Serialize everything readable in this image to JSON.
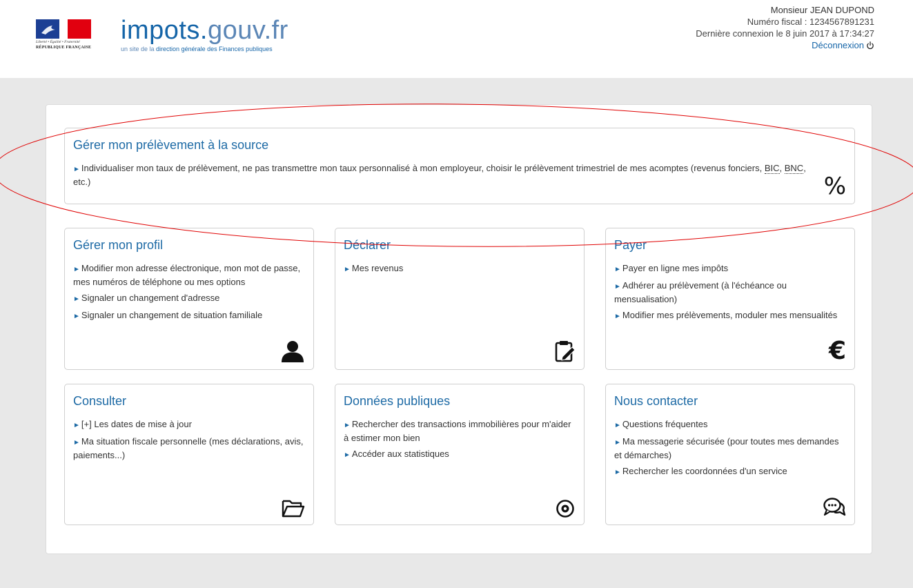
{
  "header": {
    "republique": {
      "motto": "Liberté • Égalité • Fraternité",
      "name": "RÉPUBLIQUE FRANÇAISE"
    },
    "logo": {
      "name_main": "impots.",
      "name_domain": "gouv.fr",
      "tagline_prefix": "un site de la ",
      "tagline_main": "direction générale des Finances publiques"
    },
    "user": {
      "name": "Monsieur JEAN DUPOND",
      "fiscal_number": "Numéro fiscal : 1234567891231",
      "last_login": "Dernière connexion le 8 juin 2017 à 17:34:27",
      "logout_label": "Déconnexion"
    }
  },
  "cards": {
    "prelevement": {
      "title": "Gérer mon prélèvement à la source",
      "item_text": "Individualiser mon taux de prélèvement, ne pas transmettre mon taux personnalisé à mon employeur, choisir le prélèvement trimestriel de mes acomptes (revenus fonciers, ",
      "abbr1": "BIC",
      "sep": ", ",
      "abbr2": "BNC",
      "tail": ", etc.)",
      "icon_symbol": "%",
      "icon": "percent-icon"
    },
    "profil": {
      "title": "Gérer mon profil",
      "items": [
        "Modifier mon adresse électronique, mon mot de passe, mes numéros de téléphone ou mes options",
        "Signaler un changement d'adresse",
        "Signaler un changement de situation familiale"
      ],
      "icon": "user-icon"
    },
    "declarer": {
      "title": "Déclarer",
      "items": [
        "Mes revenus"
      ],
      "icon": "clipboard-edit-icon"
    },
    "payer": {
      "title": "Payer",
      "items": [
        "Payer en ligne mes impôts",
        "Adhérer au prélèvement (à l'échéance ou mensualisation)",
        "Modifier mes prélèvements, moduler mes mensualités"
      ],
      "icon_symbol": "€",
      "icon": "euro-icon"
    },
    "consulter": {
      "title": "Consulter",
      "items": [
        "[+] Les dates de mise à jour",
        "Ma situation fiscale personnelle (mes déclarations, avis, paiements...)"
      ],
      "icon": "folder-open-icon"
    },
    "donnees": {
      "title": "Données publiques",
      "items": [
        "Rechercher des transactions immobilières pour m'aider à estimer mon bien",
        "Accéder aux statistiques"
      ],
      "icon": "eye-icon"
    },
    "contact": {
      "title": "Nous contacter",
      "items": [
        "Questions fréquentes",
        "Ma messagerie sécurisée (pour toutes mes demandes et démarches)",
        "Rechercher les coordonnées d'un service"
      ],
      "icon": "chat-bubbles-icon"
    }
  },
  "colors": {
    "accent": "#1d6aa5",
    "background": "#e8e8e8",
    "annotation": "#e00000"
  }
}
